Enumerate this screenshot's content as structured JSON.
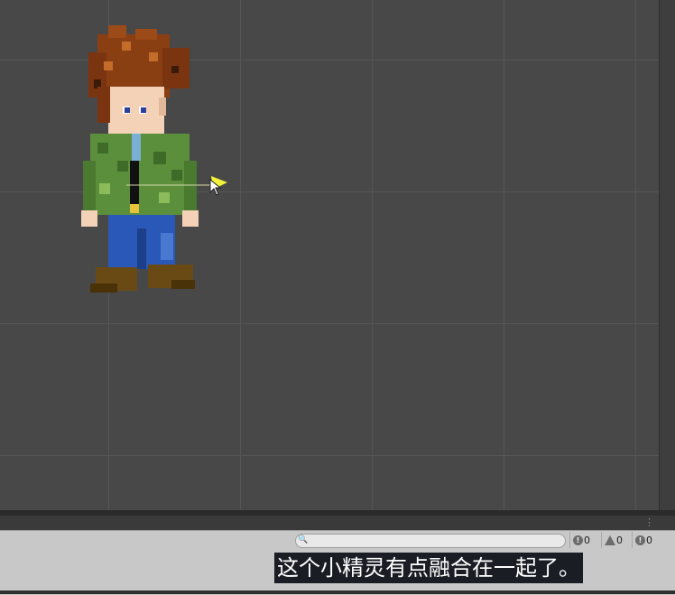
{
  "scene": {
    "grid": true
  },
  "console": {
    "search_placeholder": "",
    "search_icon": "🔍",
    "counts": {
      "messages": "0",
      "warnings": "0",
      "errors": "0"
    },
    "menu_icon": "⋮"
  },
  "subtitle": {
    "text": "这个小精灵有点融合在一起了。"
  },
  "colors": {
    "scene_bg": "#484848",
    "grid_line": "#555555",
    "console_bg": "#c8c8c8",
    "subtitle_bg": "#1a1d24",
    "gizmo_yellow": "#f2f23a"
  }
}
